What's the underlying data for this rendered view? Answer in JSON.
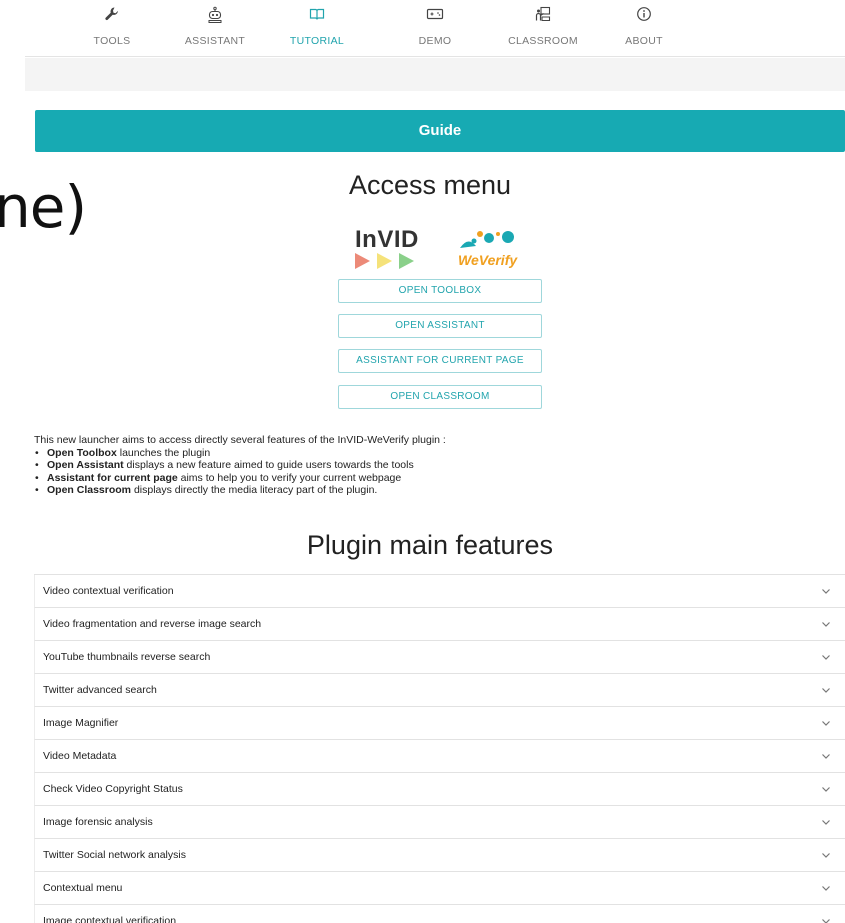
{
  "nav": {
    "tabs": [
      {
        "label": "TOOLS",
        "icon": "wrench-icon",
        "active": false
      },
      {
        "label": "ASSISTANT",
        "icon": "robot-icon",
        "active": false
      },
      {
        "label": "TUTORIAL",
        "icon": "book-icon",
        "active": true
      },
      {
        "label": "DEMO",
        "icon": "gamepad-icon",
        "active": false
      },
      {
        "label": "CLASSROOM",
        "icon": "classroom-icon",
        "active": false
      },
      {
        "label": "ABOUT",
        "icon": "info-icon",
        "active": false
      }
    ]
  },
  "background_fragment": "ne)",
  "guide": {
    "label": "Guide"
  },
  "access_menu": {
    "title": "Access menu",
    "logo_invid": "InVID",
    "logo_weverify": "WeVerify",
    "buttons": [
      "OPEN TOOLBOX",
      "OPEN ASSISTANT",
      "ASSISTANT FOR CURRENT PAGE",
      "OPEN CLASSROOM"
    ]
  },
  "description": {
    "intro": "This new launcher aims to access directly several features of the InVID-WeVerify plugin :",
    "items": [
      {
        "bold": "Open Toolbox",
        "text": " launches the plugin"
      },
      {
        "bold": "Open Assistant",
        "text": " displays a new feature aimed to guide users towards the tools"
      },
      {
        "bold": "Assistant for current page",
        "text": " aims to help you to verify your current webpage"
      },
      {
        "bold": "Open Classroom",
        "text": " displays directly the media literacy part of the plugin."
      }
    ]
  },
  "features": {
    "title": "Plugin main features",
    "items": [
      "Video contextual verification",
      "Video fragmentation and reverse image search",
      "YouTube thumbnails reverse search",
      "Twitter advanced search",
      "Image Magnifier",
      "Video Metadata",
      "Check Video Copyright Status",
      "Image forensic analysis",
      "Twitter Social network analysis",
      "Contextual menu",
      "Image contextual verification"
    ]
  },
  "colors": {
    "accent": "#17aab3",
    "accent_text": "#21a4ad",
    "border": "#e2e2e2"
  }
}
